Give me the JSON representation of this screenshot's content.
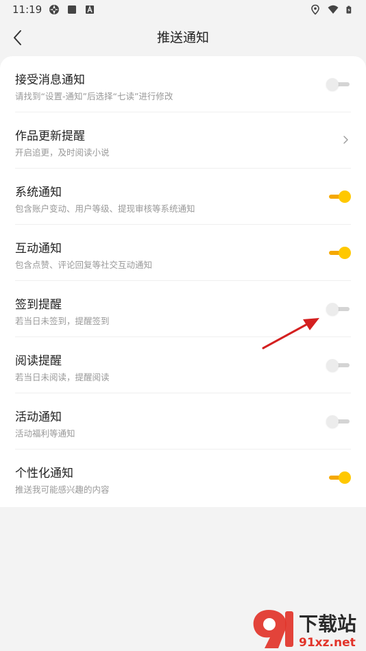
{
  "status_bar": {
    "time": "11:19",
    "left_icons": [
      "aperture-icon",
      "square-icon",
      "a-box-icon"
    ],
    "right_icons": [
      "location-icon",
      "wifi-icon",
      "battery-charging-icon"
    ]
  },
  "header": {
    "title": "推送通知",
    "back_icon": "chevron-left-icon"
  },
  "settings": {
    "items": [
      {
        "title": "接受消息通知",
        "subtitle": "请找到“设置-通知”后选择“七读”进行修改",
        "control": "toggle",
        "on": false
      },
      {
        "title": "作品更新提醒",
        "subtitle": "开启追更，及时阅读小说",
        "control": "chevron",
        "on": false
      },
      {
        "title": "系统通知",
        "subtitle": "包含账户变动、用户等级、提现审核等系统通知",
        "control": "toggle",
        "on": true
      },
      {
        "title": "互动通知",
        "subtitle": "包含点赞、评论回复等社交互动通知",
        "control": "toggle",
        "on": true
      },
      {
        "title": "签到提醒",
        "subtitle": "若当日未签到，提醒签到",
        "control": "toggle",
        "on": false
      },
      {
        "title": "阅读提醒",
        "subtitle": "若当日未阅读，提醒阅读",
        "control": "toggle",
        "on": false
      },
      {
        "title": "活动通知",
        "subtitle": "活动福利等通知",
        "control": "toggle",
        "on": false
      },
      {
        "title": "个性化通知",
        "subtitle": "推送我可能感兴趣的内容",
        "control": "toggle",
        "on": true
      }
    ]
  },
  "colors": {
    "toggle_on_track": "#f5a800",
    "toggle_on_thumb": "#ffc800",
    "toggle_off_track": "#d4d4d4",
    "toggle_off_thumb": "#ececec",
    "annotation_arrow": "#d42020",
    "watermark_red": "#e2342a"
  },
  "watermark": {
    "logo_text": "91",
    "brand_text": "下载站",
    "domain_text": "91xz.net"
  }
}
